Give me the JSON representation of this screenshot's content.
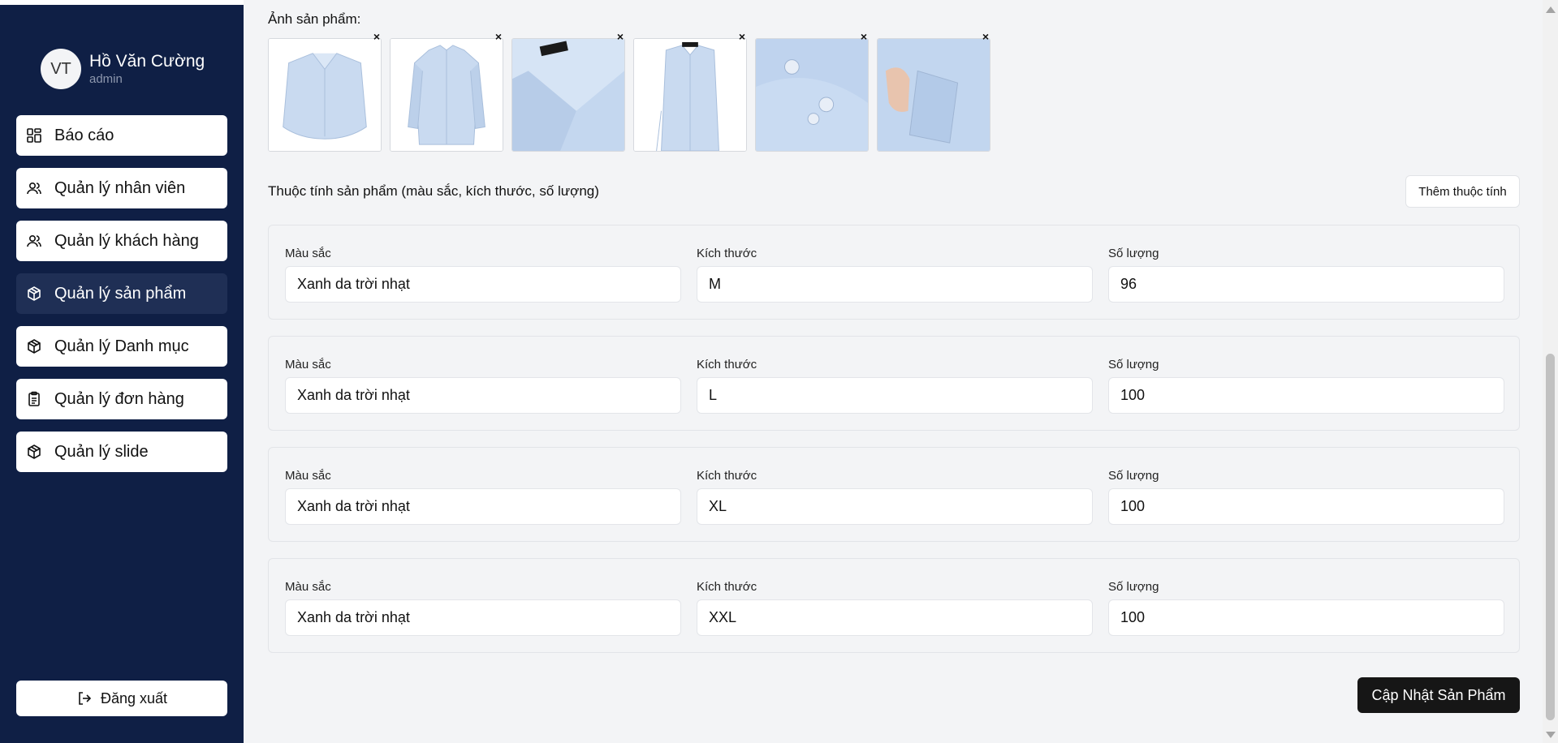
{
  "user": {
    "initials": "VT",
    "name": "Hồ Văn Cường",
    "role": "admin"
  },
  "nav": {
    "items": [
      {
        "label": "Báo cáo",
        "icon": "dashboard-icon",
        "active": false
      },
      {
        "label": "Quản lý nhân viên",
        "icon": "users-icon",
        "active": false
      },
      {
        "label": "Quản lý khách hàng",
        "icon": "users-icon",
        "active": false
      },
      {
        "label": "Quản lý sản phẩm",
        "icon": "box-icon",
        "active": true
      },
      {
        "label": "Quản lý Danh mục",
        "icon": "box-icon",
        "active": false
      },
      {
        "label": "Quản lý đơn hàng",
        "icon": "clipboard-icon",
        "active": false
      },
      {
        "label": "Quản lý slide",
        "icon": "box-icon",
        "active": false
      }
    ],
    "logout_label": "Đăng xuất"
  },
  "images": {
    "label": "Ảnh sản phẩm:",
    "remove_symbol": "×",
    "count": 6
  },
  "attributes": {
    "title": "Thuộc tính sản phẩm (màu sắc, kích thước, số lượng)",
    "add_button": "Thêm thuộc tính",
    "labels": {
      "color": "Màu sắc",
      "size": "Kích thước",
      "quantity": "Số lượng"
    },
    "rows": [
      {
        "color": "Xanh da trời nhạt",
        "size": "M",
        "quantity": "96"
      },
      {
        "color": "Xanh da trời nhạt",
        "size": "L",
        "quantity": "100"
      },
      {
        "color": "Xanh da trời nhạt",
        "size": "XL",
        "quantity": "100"
      },
      {
        "color": "Xanh da trời nhạt",
        "size": "XXL",
        "quantity": "100"
      }
    ]
  },
  "submit_label": "Cập Nhật Sản Phẩm",
  "colors": {
    "sidebar": "#0f1f45",
    "active_nav": "#1f2f55",
    "submit": "#161616",
    "shirt": "#c9daf0"
  }
}
